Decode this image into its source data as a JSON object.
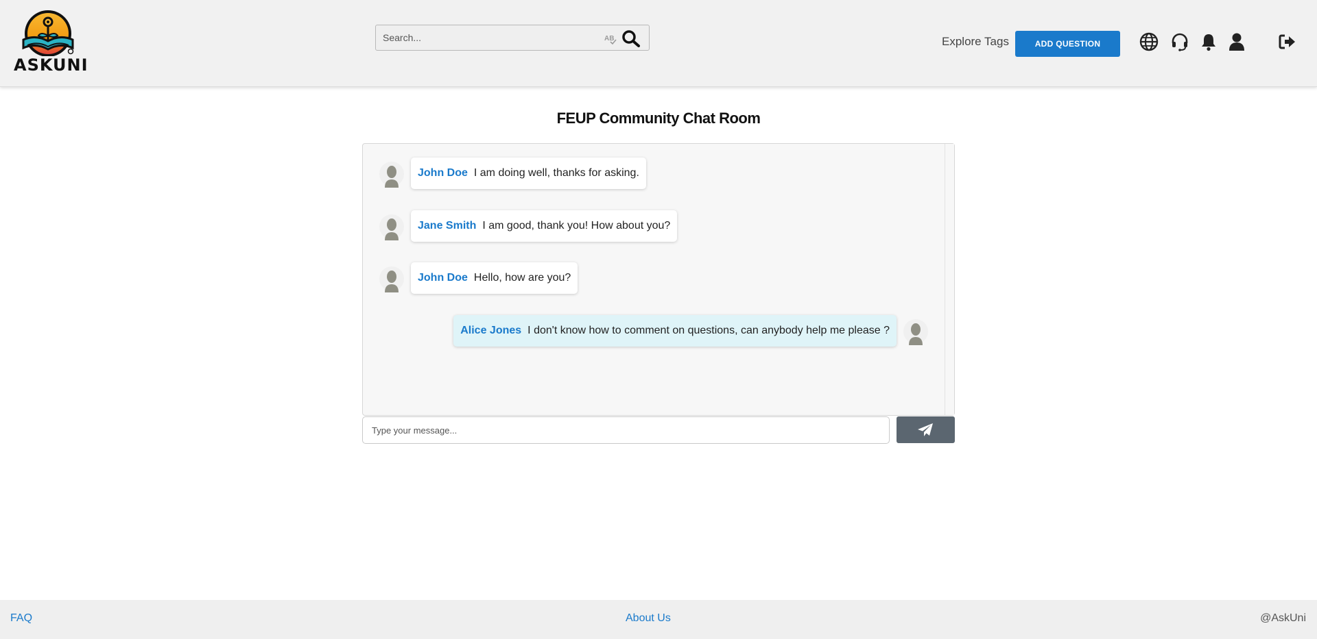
{
  "header": {
    "logo_text": "ASKUNI",
    "search": {
      "placeholder": "Search..."
    },
    "explore_tags": "Explore Tags",
    "add_question": "ADD QUESTION",
    "icons": [
      "globe-icon",
      "headset-icon",
      "bell-icon",
      "user-icon",
      "logout-icon"
    ]
  },
  "main": {
    "title": "FEUP Community Chat Room",
    "messages": [
      {
        "author": "John Doe",
        "text": "I am doing well, thanks for asking.",
        "own": false
      },
      {
        "author": "Jane Smith",
        "text": "I am good, thank you! How about you?",
        "own": false
      },
      {
        "author": "John Doe",
        "text": "Hello, how are you?",
        "own": false
      },
      {
        "author": "Alice Jones",
        "text": "I don't know how to comment on questions, can anybody help me please ?",
        "own": true
      }
    ],
    "input": {
      "placeholder": "Type your message..."
    },
    "send_icon": "paper-plane-icon"
  },
  "footer": {
    "faq": "FAQ",
    "about": "About Us",
    "copyright": "@AskUni"
  },
  "colors": {
    "accent": "#1a7acb",
    "header_bg": "#f1f1f1",
    "own_bubble": "#dff4f8",
    "send_button": "#5b6670",
    "logo_orange": "#f5a623",
    "logo_teal": "#2bb3c4",
    "logo_red": "#e0443a"
  }
}
